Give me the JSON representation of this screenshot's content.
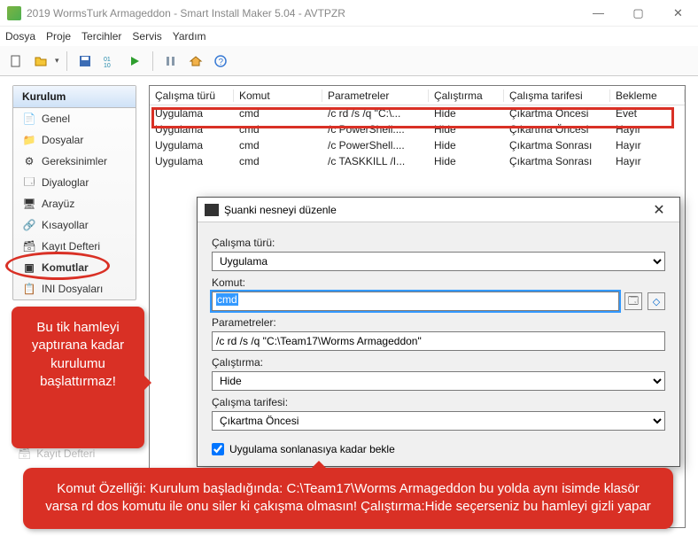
{
  "window": {
    "title": "2019 WormsTurk Armageddon - Smart Install Maker 5.04 - AVTPZR"
  },
  "menu": [
    "Dosya",
    "Proje",
    "Tercihler",
    "Servis",
    "Yardım"
  ],
  "sidebar": {
    "header": "Kurulum",
    "items": [
      {
        "icon": "📄",
        "label": "Genel"
      },
      {
        "icon": "📁",
        "label": "Dosyalar"
      },
      {
        "icon": "⚙",
        "label": "Gereksinimler"
      },
      {
        "icon": "🗔",
        "label": "Diyaloglar"
      },
      {
        "icon": "🖥",
        "label": "Arayüz"
      },
      {
        "icon": "🔗",
        "label": "Kısayollar"
      },
      {
        "icon": "🗃",
        "label": "Kayıt Defteri"
      },
      {
        "icon": "▣",
        "label": "Komutlar"
      },
      {
        "icon": "📋",
        "label": "INI Dosyaları"
      }
    ]
  },
  "table": {
    "headers": [
      "Çalışma türü",
      "Komut",
      "Parametreler",
      "Çalıştırma",
      "Çalışma tarifesi",
      "Bekleme"
    ],
    "rows": [
      [
        "Uygulama",
        "cmd",
        "/c rd /s /q \"C:\\...",
        "Hide",
        "Çıkartma Öncesi",
        "Evet"
      ],
      [
        "Uygulama",
        "cmd",
        "/c PowerShell....",
        "Hide",
        "Çıkartma Öncesi",
        "Hayır"
      ],
      [
        "Uygulama",
        "cmd",
        "/c PowerShell....",
        "Hide",
        "Çıkartma Sonrası",
        "Hayır"
      ],
      [
        "Uygulama",
        "cmd",
        "/c TASKKILL /I...",
        "Hide",
        "Çıkartma Sonrası",
        "Hayır"
      ]
    ]
  },
  "dialog": {
    "title": "Şuanki nesneyi düzenle",
    "labels": {
      "runtype": "Çalışma türü:",
      "command": "Komut:",
      "params": "Parametreler:",
      "run": "Çalıştırma:",
      "schedule": "Çalışma tarifesi:"
    },
    "values": {
      "runtype": "Uygulama",
      "command": "cmd",
      "params": "/c rd /s /q \"C:\\Team17\\Worms Armageddon\"",
      "run": "Hide",
      "schedule": "Çıkartma Öncesi"
    },
    "checkbox": "Uygulama sonlanasıya kadar bekle"
  },
  "callouts": {
    "left": "Bu tik hamleyi yaptırana kadar kurulumu başlattırmaz!",
    "bottom": "Komut Özelliği: Kurulum başladığında: C:\\Team17\\Worms Armageddon bu yolda aynı isimde klasör varsa rd dos komutu ile onu siler ki çakışma olmasın! Çalıştırma:Hide seçerseniz bu hamleyi gizli yapar"
  },
  "faded": "Kayıt Defteri"
}
